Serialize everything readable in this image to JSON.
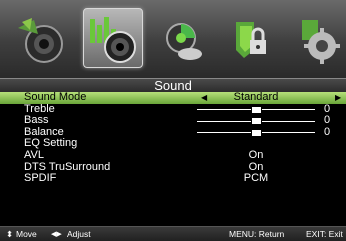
{
  "icons": [
    {
      "name": "picture-icon"
    },
    {
      "name": "sound-icon",
      "selected": true
    },
    {
      "name": "channel-icon"
    },
    {
      "name": "lock-icon"
    },
    {
      "name": "setup-icon"
    }
  ],
  "title": "Sound",
  "menu": {
    "sound_mode": {
      "label": "Sound Mode",
      "value": "Standard"
    },
    "treble": {
      "label": "Treble",
      "value": "0",
      "level": 0.5
    },
    "bass": {
      "label": "Bass",
      "value": "0",
      "level": 0.5
    },
    "balance": {
      "label": "Balance",
      "value": "0",
      "level": 0.5
    },
    "eq_setting": {
      "label": "EQ Setting"
    },
    "avl": {
      "label": "AVL",
      "value": "On"
    },
    "dts": {
      "label": "DTS TruSurround",
      "value": "On"
    },
    "spdif": {
      "label": "SPDIF",
      "value": "PCM"
    }
  },
  "arrows": {
    "left": "◀",
    "right": "▶"
  },
  "help": {
    "move_icon": "⬍",
    "move": "Move",
    "adjust_icon": "◀▶",
    "adjust": "Adjust",
    "menu_return": "MENU: Return",
    "exit": "EXIT: Exit"
  },
  "colors": {
    "highlight": "#8cc84a",
    "background": "#000000"
  }
}
